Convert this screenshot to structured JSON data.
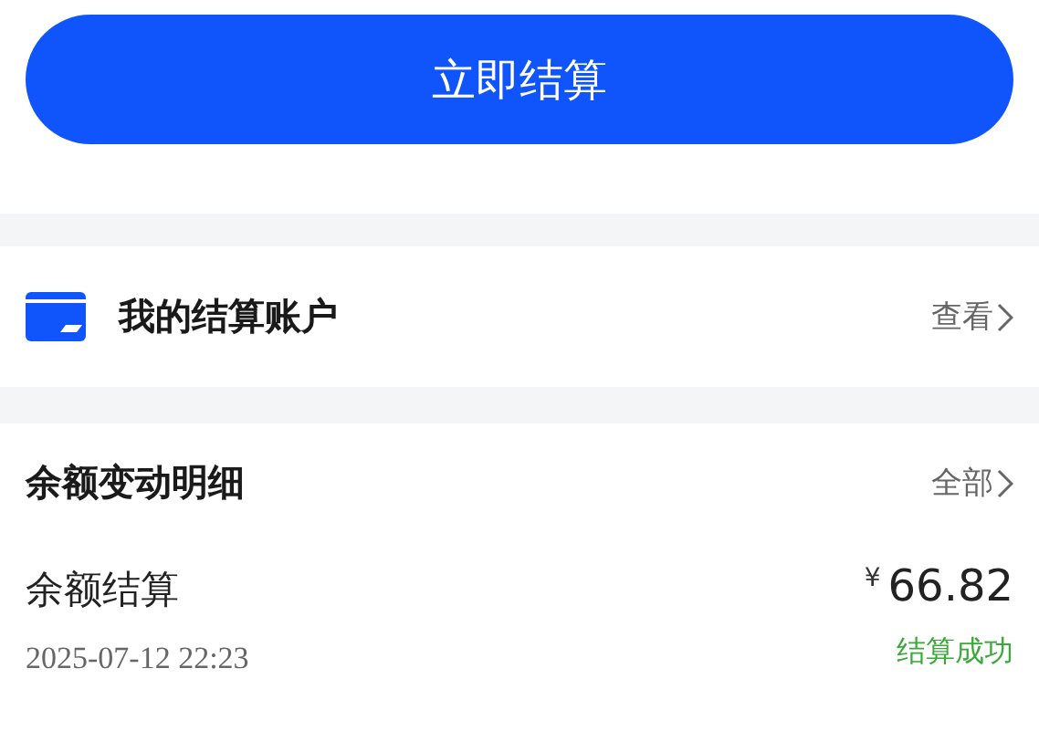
{
  "primary_button": {
    "label": "立即结算"
  },
  "account_row": {
    "title": "我的结算账户",
    "link": "查看"
  },
  "history": {
    "title": "余额变动明细",
    "link": "全部",
    "records": [
      {
        "title": "余额结算",
        "time": "2025-07-12 22:23",
        "currency": "¥",
        "amount": "66.82",
        "status": "结算成功",
        "kind": "success"
      }
    ]
  }
}
